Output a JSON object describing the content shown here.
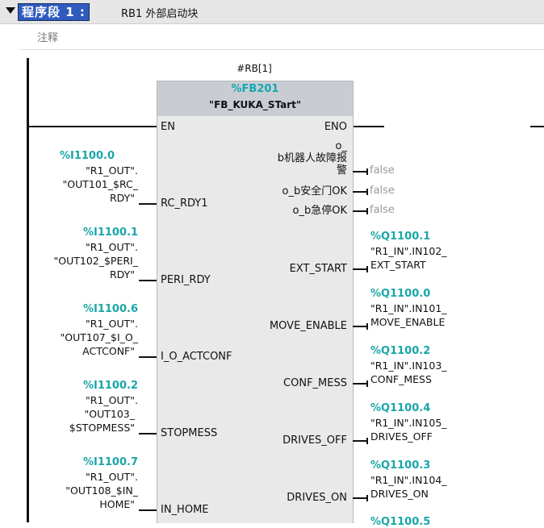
{
  "network": {
    "title": "程序段 1 :",
    "name": "RB1 外部启动块",
    "comment": "注释"
  },
  "block": {
    "instance": "#RB[1]",
    "fb_number": "%FB201",
    "fb_name": "\"FB_KUKA_STart\"",
    "en": "EN",
    "eno": "ENO"
  },
  "inputs": [
    {
      "addr": "%I1100.0",
      "sym1": "\"R1_OUT\".",
      "sym2": "\"OUT101_$RC_",
      "sym3": "RDY\"",
      "pin": "RC_RDY1"
    },
    {
      "addr": "%I1100.1",
      "sym1": "\"R1_OUT\".",
      "sym2": "\"OUT102_$PERI_",
      "sym3": "RDY\"",
      "pin": "PERI_RDY"
    },
    {
      "addr": "%I1100.6",
      "sym1": "\"R1_OUT\".",
      "sym2": "\"OUT107_$I_O_",
      "sym3": "ACTCONF\"",
      "pin": "I_O_ACTCONF"
    },
    {
      "addr": "%I1100.2",
      "sym1": "\"R1_OUT\".",
      "sym2": "\"OUT103_",
      "sym3": "$STOPMESS\"",
      "pin": "STOPMESS"
    },
    {
      "addr": "%I1100.7",
      "sym1": "\"R1_OUT\".",
      "sym2": "\"OUT108_$IN_",
      "sym3": "HOME\"",
      "pin": "IN_HOME"
    }
  ],
  "bool_outputs": [
    {
      "pin1": "o_",
      "pin2": "b机器人故障报",
      "pin3": "警",
      "value": "false"
    },
    {
      "pin": "o_b安全门OK",
      "value": "false"
    },
    {
      "pin": "o_b急停OK",
      "value": "false"
    }
  ],
  "outputs": [
    {
      "addr": "%Q1100.1",
      "sym1": "\"R1_IN\".IN102_",
      "sym2": "EXT_START",
      "pin": "EXT_START"
    },
    {
      "addr": "%Q1100.0",
      "sym1": "\"R1_IN\".IN101_",
      "sym2": "MOVE_ENABLE",
      "pin": "MOVE_ENABLE"
    },
    {
      "addr": "%Q1100.2",
      "sym1": "\"R1_IN\".IN103_",
      "sym2": "CONF_MESS",
      "pin": "CONF_MESS"
    },
    {
      "addr": "%Q1100.4",
      "sym1": "\"R1_IN\".IN105_",
      "sym2": "DRIVES_OFF",
      "pin": "DRIVES_OFF"
    },
    {
      "addr": "%Q1100.3",
      "sym1": "\"R1_IN\".IN104_",
      "sym2": "DRIVES_ON",
      "pin": "DRIVES_ON"
    },
    {
      "addr": "%Q1100.5"
    }
  ]
}
